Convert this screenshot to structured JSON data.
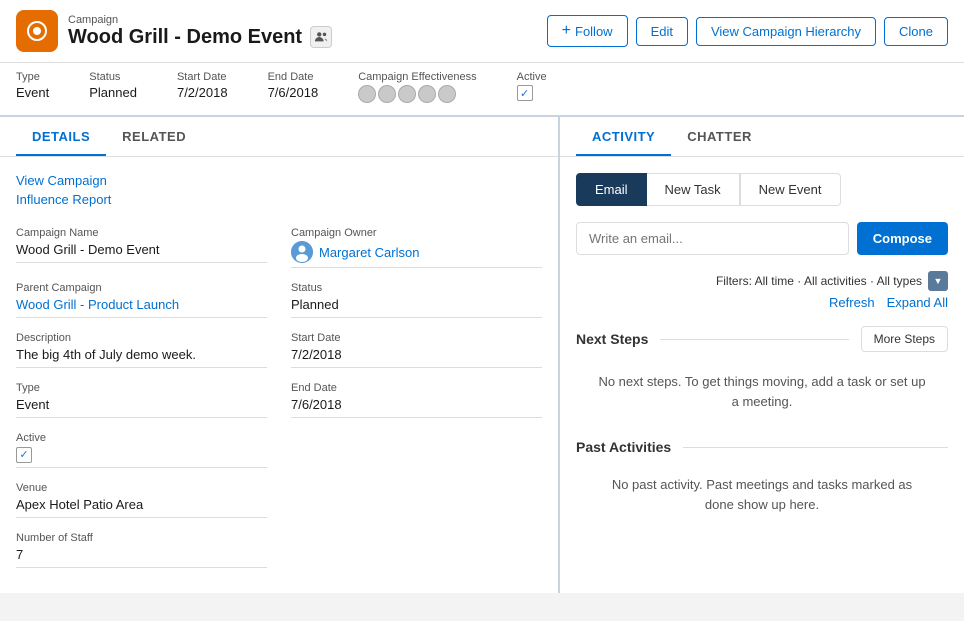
{
  "header": {
    "breadcrumb": "Campaign",
    "title": "Wood Grill - Demo Event",
    "follow_label": "Follow",
    "edit_label": "Edit",
    "view_hierarchy_label": "View Campaign Hierarchy",
    "clone_label": "Clone"
  },
  "meta": {
    "type_label": "Type",
    "type_value": "Event",
    "status_label": "Status",
    "status_value": "Planned",
    "start_date_label": "Start Date",
    "start_date_value": "7/2/2018",
    "end_date_label": "End Date",
    "end_date_value": "7/6/2018",
    "effectiveness_label": "Campaign Effectiveness",
    "active_label": "Active"
  },
  "left_panel": {
    "tab_details": "DETAILS",
    "tab_related": "RELATED",
    "view_campaign": "View Campaign",
    "influence_report": "Influence Report",
    "fields": {
      "campaign_name_label": "Campaign Name",
      "campaign_name_value": "Wood Grill - Demo Event",
      "campaign_owner_label": "Campaign Owner",
      "campaign_owner_value": "Margaret Carlson",
      "parent_campaign_label": "Parent Campaign",
      "parent_campaign_value": "Wood Grill - Product Launch",
      "status_label": "Status",
      "status_value": "Planned",
      "description_label": "Description",
      "description_value": "The big 4th of July demo week.",
      "start_date_label": "Start Date",
      "start_date_value": "7/2/2018",
      "type_label": "Type",
      "type_value": "Event",
      "end_date_label": "End Date",
      "end_date_value": "7/6/2018",
      "active_label": "Active",
      "venue_label": "Venue",
      "venue_value": "Apex Hotel Patio Area",
      "num_staff_label": "Number of Staff",
      "num_staff_value": "7"
    }
  },
  "right_panel": {
    "tab_activity": "ACTIVITY",
    "tab_chatter": "CHATTER",
    "email_tab": "Email",
    "new_task_tab": "New Task",
    "new_event_tab": "New Event",
    "email_placeholder": "Write an email...",
    "compose_label": "Compose",
    "filters_text": "Filters: All time · All activities · All types",
    "refresh_label": "Refresh",
    "expand_all_label": "Expand All",
    "next_steps_title": "Next Steps",
    "more_steps_label": "More Steps",
    "next_steps_empty": "No next steps. To get things moving, add a task or set up a meeting.",
    "past_activities_title": "Past Activities",
    "past_activities_empty": "No past activity. Past meetings and tasks marked as done show up here."
  }
}
